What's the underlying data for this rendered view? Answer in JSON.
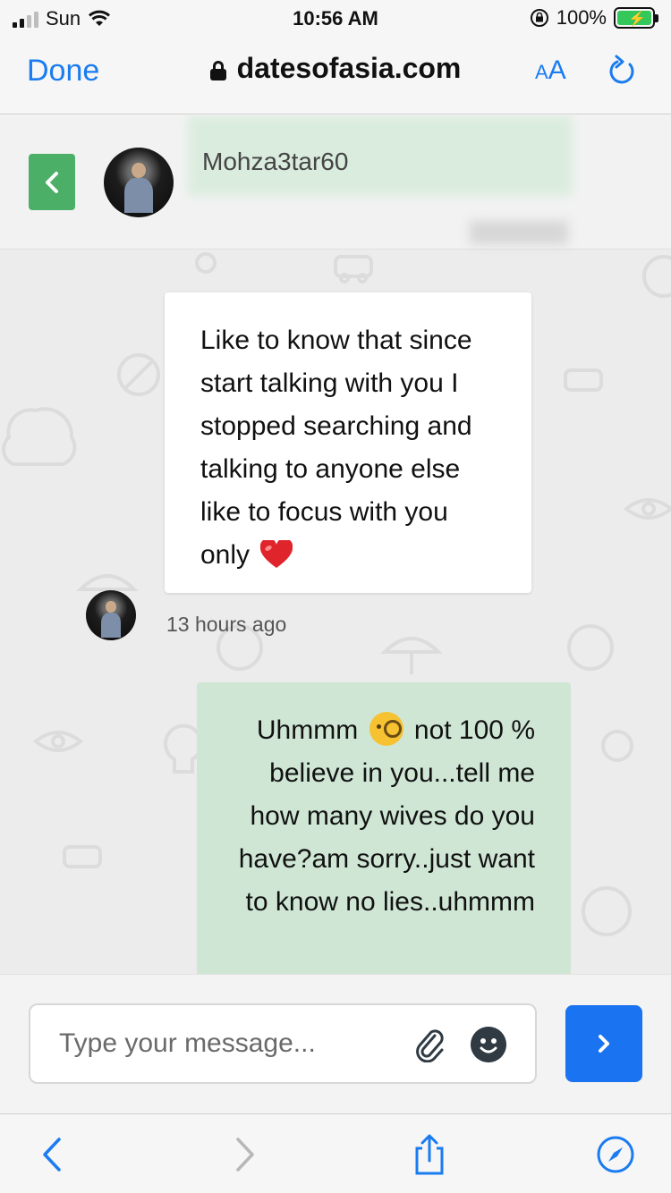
{
  "status_bar": {
    "carrier": "Sun",
    "time": "10:56 AM",
    "battery": "100%"
  },
  "browser": {
    "done_label": "Done",
    "url": "datesofasia.com",
    "aa_small": "A",
    "aa_big": "A"
  },
  "chat": {
    "username": "Mohza3tar60",
    "messages": [
      {
        "direction": "incoming",
        "text": "Like to know that since start talking with you I stopped searching and talking to anyone else like to focus with you only",
        "emoji": "heart",
        "time": "13 hours ago"
      },
      {
        "direction": "outgoing",
        "text_before": "Uhmmm",
        "emoji": "face-with-monocle",
        "text_after": "not 100 % believe in you...tell me how many wives do you have?am sorry..just want to know no lies..uhmmm"
      }
    ]
  },
  "composer": {
    "placeholder": "Type your message..."
  },
  "colors": {
    "accent": "#1a73f0",
    "back_button": "#4caf68",
    "outgoing_bubble": "#cfe6d5",
    "safari_blue": "#1a7cf0"
  }
}
